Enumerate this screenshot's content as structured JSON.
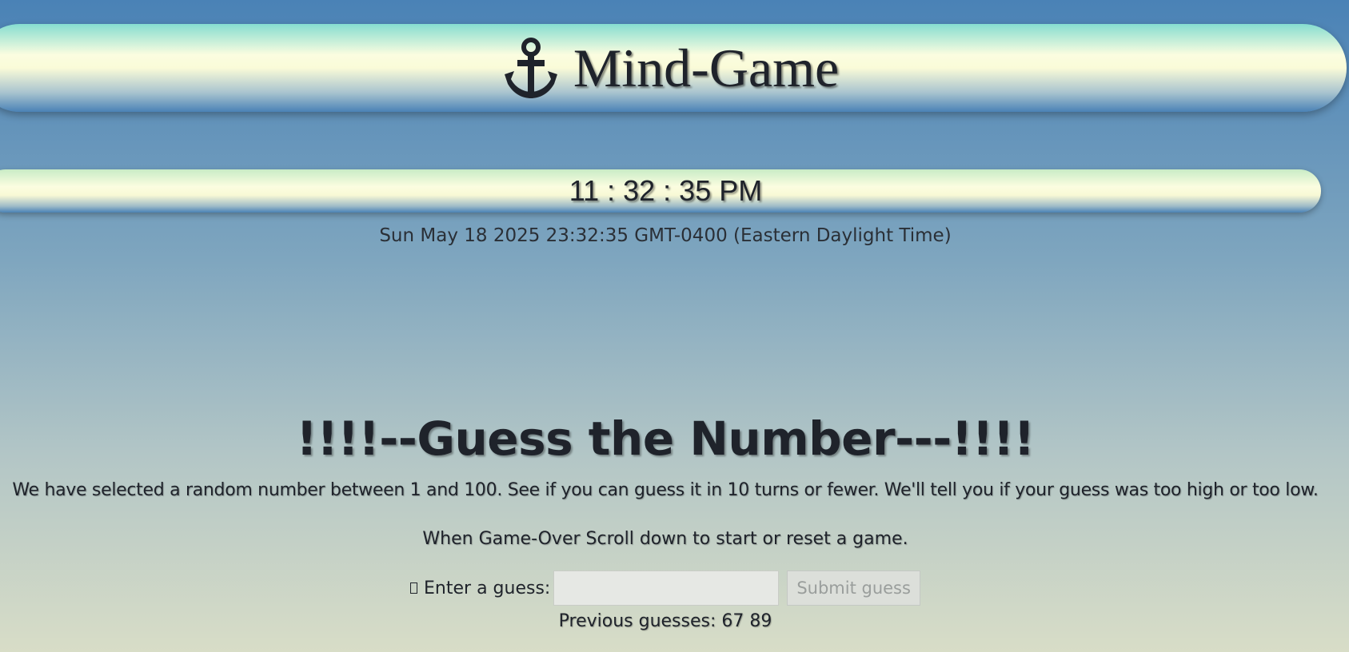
{
  "header": {
    "title": "Mind-Game",
    "icon": "anchor-icon"
  },
  "clock": {
    "time": "11 : 32 : 35 PM",
    "date": "Sun May 18 2025 23:32:35 GMT-0400 (Eastern Daylight Time)"
  },
  "game": {
    "heading": "!!!!--Guess the Number---!!!!",
    "description": "We have selected a random number between 1 and 100. See if you can guess it in 10 turns or fewer. We'll tell you if your guess was too high or too low.",
    "instruction": "When Game-Over Scroll down to start or reset a game.",
    "guess_label": "Enter a guess:",
    "guess_value": "",
    "submit_label": "Submit guess",
    "previous_guesses": "Previous guesses: 67 89"
  },
  "colors": {
    "text": "#1f232b",
    "background_top": "#4a82b6",
    "background_bottom": "#d8ddc7"
  }
}
